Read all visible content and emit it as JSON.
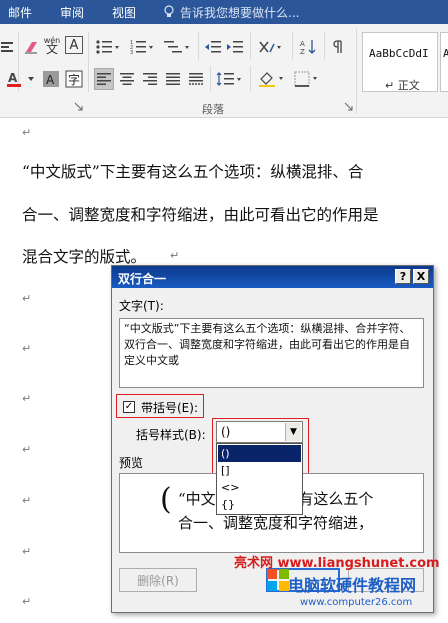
{
  "ribbon_tabs": [
    "邮件",
    "审阅",
    "视图"
  ],
  "tell_me": "告诉我您想要做什么...",
  "ribbon": {
    "group_label": "段落",
    "wen_label": "wén",
    "wen_char": "文",
    "a_char": "A",
    "styles": [
      {
        "sample": "AaBbCcDdI",
        "name": "↵ 正文"
      },
      {
        "sample": "A",
        "name": ""
      }
    ],
    "colors": {
      "font_color_bar": "#e02020"
    }
  },
  "document": {
    "line1": "“中文版式”下主要有这么五个选项：纵横混排、合",
    "line2": "合一、调整宽度和字符缩进，由此可看出它的作用是",
    "line3": "混合文字的版式。",
    "para_mark": "↵"
  },
  "dialog": {
    "title": "双行合一",
    "help": "?",
    "close": "X",
    "text_label": "文字(T):",
    "text_content": "“中文版式”下主要有这么五个选项：纵横混排、合并字符、双行合一、调整宽度和字符缩进，由此可看出它的作用是自定义中文或",
    "bracket_checkbox_label": "带括号(E):",
    "bracket_checked": "✓",
    "bracket_style_label": "括号样式(B):",
    "bracket_style_value": "()",
    "bracket_options": [
      "()",
      "[]",
      "<>",
      "{}"
    ],
    "preview_label": "预览",
    "preview_line1": "“中文版式”下主要有这么五个",
    "preview_line2": "合一、调整宽度和字符缩进，",
    "preview_paren": "(",
    "delete_button": "删除(R)"
  },
  "watermarks": {
    "line1": "亮术网 www.liangshunet.com",
    "line2": "电脑软硬件教程网",
    "line3": "www.computer26.com"
  }
}
